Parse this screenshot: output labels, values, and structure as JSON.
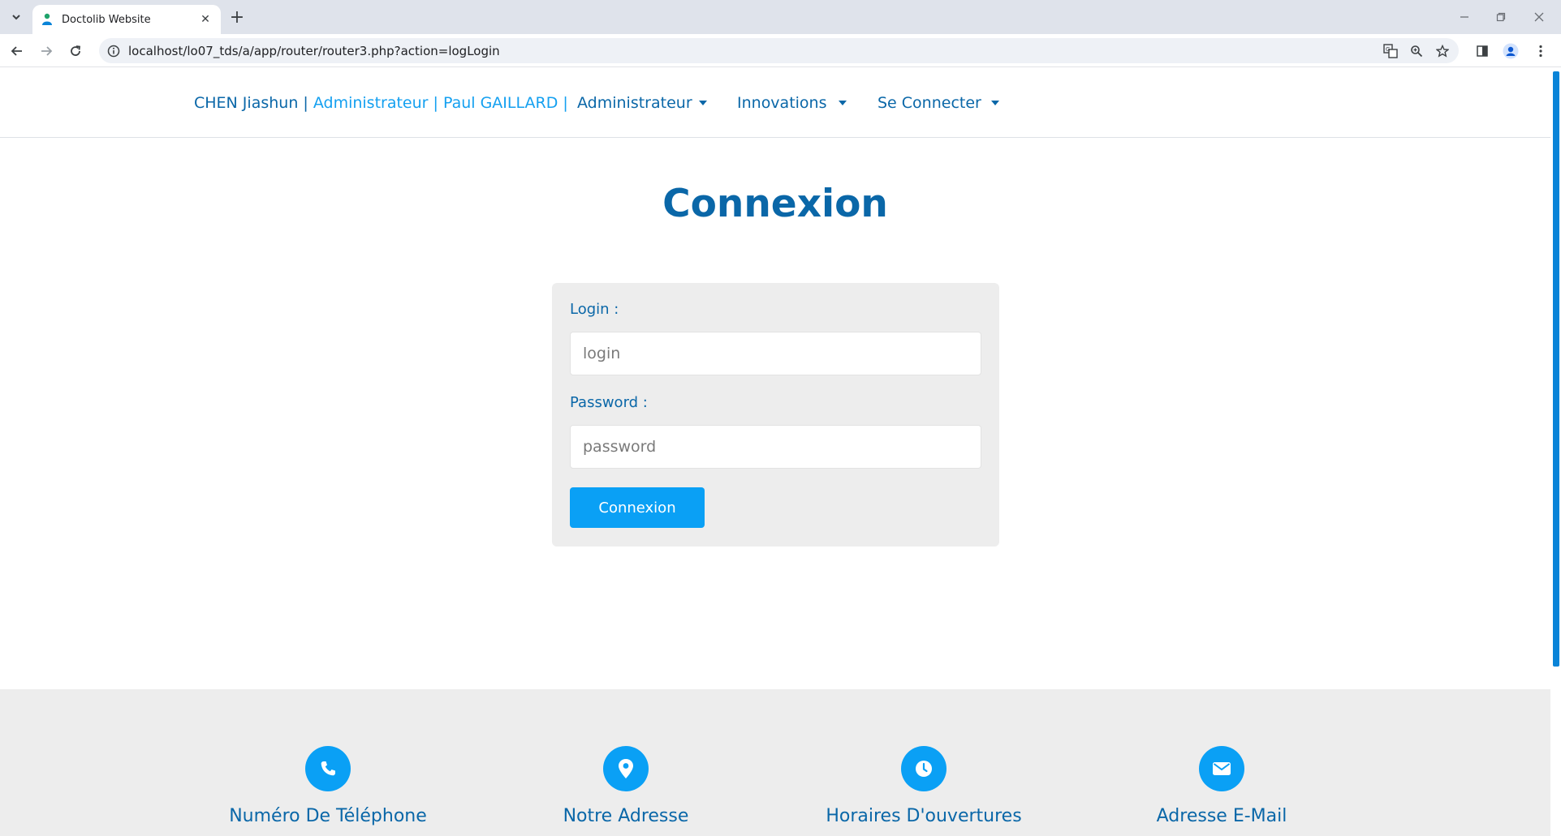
{
  "browser": {
    "tab_title": "Doctolib Website",
    "url": "localhost/lo07_tds/a/app/router/router3.php?action=logLogin",
    "icons": {
      "tab_list": "chevron-down-icon",
      "close_tab": "close-icon",
      "new_tab": "plus-icon",
      "back": "back-arrow-icon",
      "forward": "forward-arrow-icon",
      "reload": "reload-icon",
      "site_info": "info-icon",
      "translate": "translate-icon",
      "zoom": "zoom-icon",
      "bookmark": "star-icon",
      "side_panel": "side-panel-icon",
      "profile": "profile-icon",
      "menu": "kebab-menu-icon"
    }
  },
  "nav": {
    "brand_name": "CHEN Jiashun |",
    "brand_role": " Administrateur | Paul GAILLARD |",
    "menus": [
      "Administrateur",
      "Innovations",
      "Se Connecter"
    ]
  },
  "main": {
    "title": "Connexion",
    "form": {
      "login_label": "Login :",
      "login_placeholder": "login",
      "login_value": "",
      "password_label": "Password :",
      "password_placeholder": "password",
      "password_value": "",
      "submit_label": "Connexion"
    }
  },
  "footer": {
    "items": [
      {
        "icon": "phone-icon",
        "label": "Numéro De Téléphone"
      },
      {
        "icon": "map-pin-icon",
        "label": "Notre Adresse"
      },
      {
        "icon": "clock-icon",
        "label": "Horaires D'ouvertures"
      },
      {
        "icon": "envelope-icon",
        "label": "Adresse E-Mail"
      }
    ]
  },
  "colors": {
    "primary": "#0a67a8",
    "accent": "#0aa0f5",
    "panel": "#ededed"
  }
}
